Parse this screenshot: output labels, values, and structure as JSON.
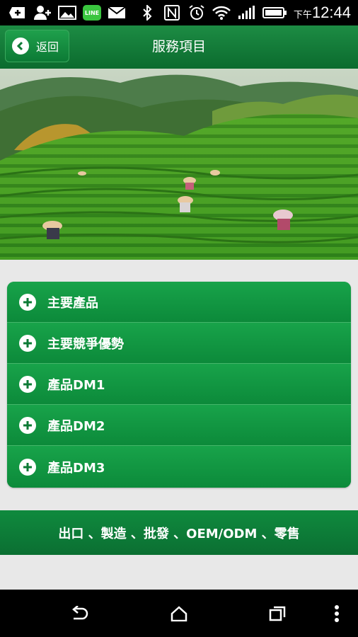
{
  "status_bar": {
    "icons": [
      "add-box-icon",
      "add-contact-icon",
      "image-icon",
      "line-app-icon",
      "mail-icon",
      "bluetooth-icon",
      "nfc-icon",
      "alarm-icon",
      "wifi-icon",
      "signal-icon",
      "battery-icon"
    ],
    "line_badge": "LINE",
    "time_prefix": "下午",
    "time": "12:44"
  },
  "app_bar": {
    "back_label": "返回",
    "title": "服務項目",
    "color": "#0b6b2e"
  },
  "menu": {
    "items": [
      {
        "label": "主要產品"
      },
      {
        "label": "主要競爭優勢"
      },
      {
        "label": "產品DM1"
      },
      {
        "label": "產品DM2"
      },
      {
        "label": "產品DM3"
      }
    ],
    "accent": "#119a44"
  },
  "footer": {
    "text": "出口 、製造 、批發 、OEM/ODM 、零售"
  },
  "nav_bar": {
    "icons": [
      "back-icon",
      "home-icon",
      "recents-icon",
      "overflow-menu-icon"
    ]
  }
}
